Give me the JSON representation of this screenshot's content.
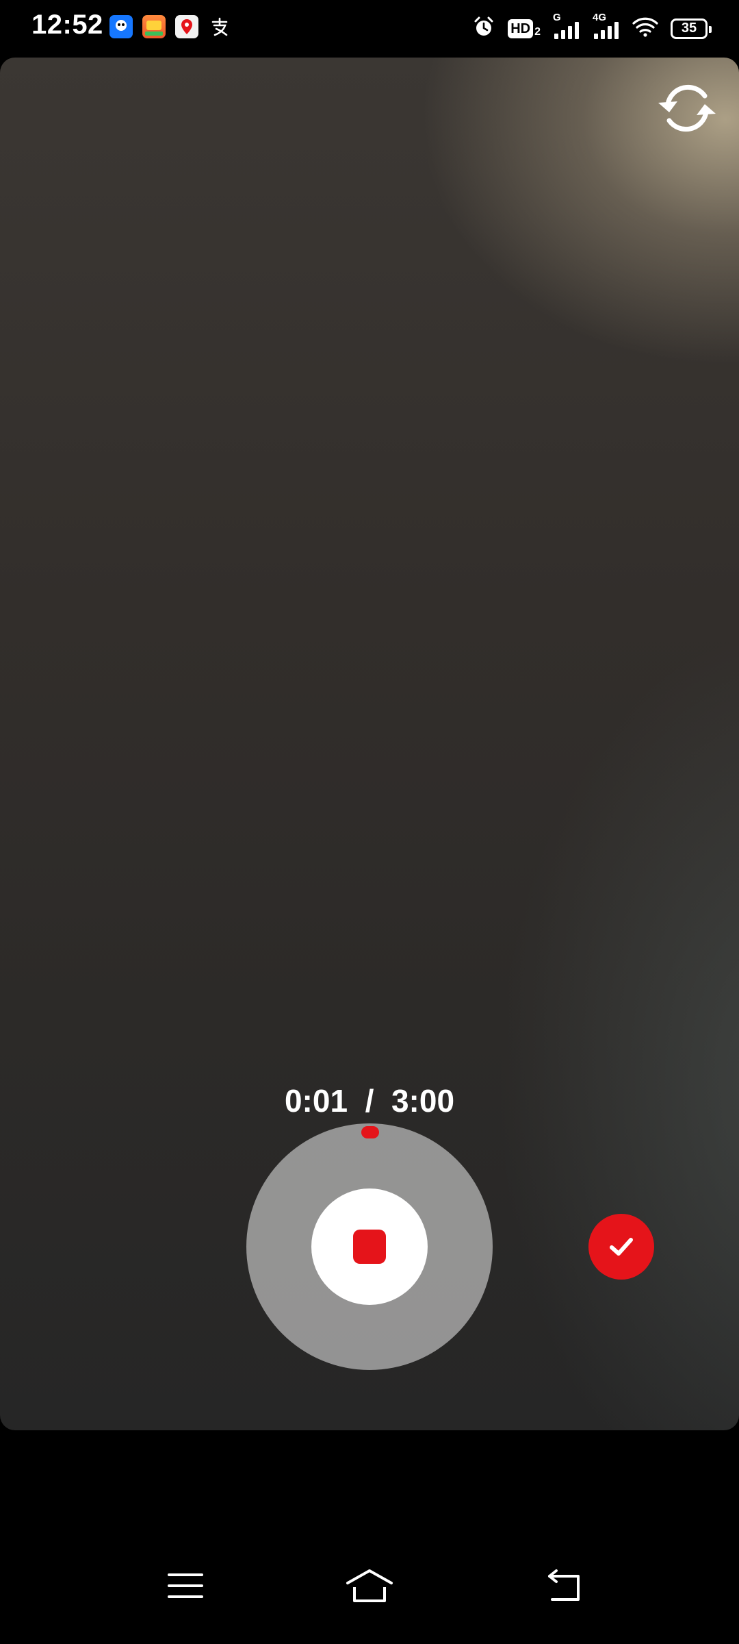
{
  "status_bar": {
    "time": "12:52",
    "notification_icons": [
      "qq-icon",
      "game-app-icon",
      "map-pin-app-icon",
      "alipay-icon"
    ],
    "network_g": "G",
    "network_4g": "4G",
    "hd_label": "HD",
    "battery": "35"
  },
  "camera": {
    "timer_elapsed": "0:01",
    "timer_separator": "/",
    "timer_total": "3:00",
    "record_progress": 0.0056
  },
  "colors": {
    "accent_red": "#e5141a",
    "ring_gray": "#bebebe"
  },
  "nav_bar": {
    "icons": [
      "menu-icon",
      "home-icon",
      "back-icon"
    ]
  }
}
